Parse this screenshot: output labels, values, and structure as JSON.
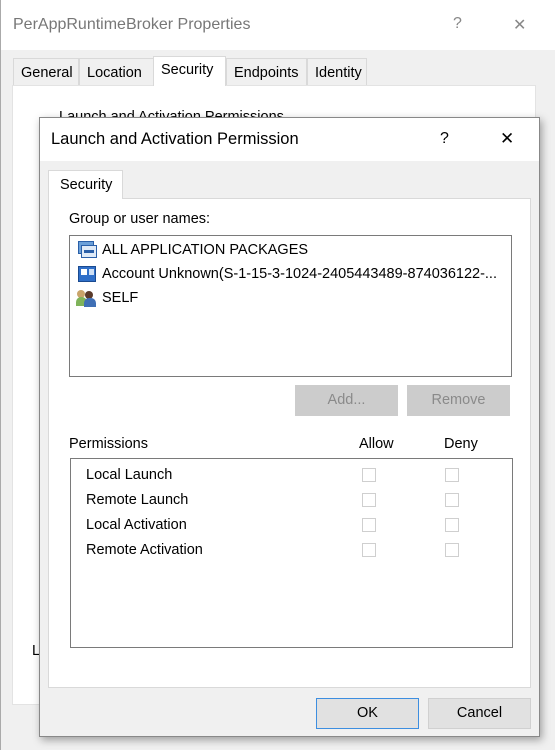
{
  "outer_window": {
    "title": "PerAppRuntimeBroker Properties",
    "help": "?",
    "close": "✕",
    "tabs": [
      {
        "label": "General"
      },
      {
        "label": "Location"
      },
      {
        "label": "Security",
        "selected": true
      },
      {
        "label": "Endpoints"
      },
      {
        "label": "Identity"
      }
    ],
    "section_heading": "Launch and Activation Permissions",
    "partial_label": "L"
  },
  "dialog": {
    "title": "Launch and Activation Permission",
    "help": "?",
    "close": "✕",
    "tab": "Security",
    "group_label": "Group or user names:",
    "principals": [
      {
        "name": "ALL APPLICATION PACKAGES",
        "icon": "app-packages-icon"
      },
      {
        "name": "Account Unknown(S-1-15-3-1024-2405443489-874036122-...",
        "icon": "unknown-account-icon"
      },
      {
        "name": "SELF",
        "icon": "users-icon"
      }
    ],
    "add_button": "Add...",
    "remove_button": "Remove",
    "permissions_label": "Permissions",
    "allow_header": "Allow",
    "deny_header": "Deny",
    "permissions": [
      {
        "name": "Local Launch",
        "allow": false,
        "deny": false
      },
      {
        "name": "Remote Launch",
        "allow": false,
        "deny": false
      },
      {
        "name": "Local Activation",
        "allow": false,
        "deny": false
      },
      {
        "name": "Remote Activation",
        "allow": false,
        "deny": false
      }
    ],
    "ok_button": "OK",
    "cancel_button": "Cancel"
  }
}
